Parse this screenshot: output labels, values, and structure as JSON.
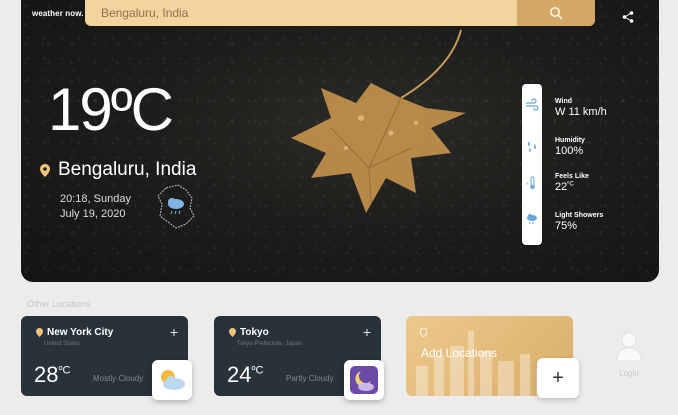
{
  "app": {
    "brand": "weather now."
  },
  "search": {
    "placeholder": "Bengaluru, India",
    "value": ""
  },
  "current": {
    "temperature": "19",
    "unit": "ºC",
    "city": "Bengaluru, India",
    "time_day": "20:18, Sunday",
    "date": "July 19, 2020"
  },
  "stats": [
    {
      "label": "Wind",
      "value": "W 11 km/h",
      "icon": "wind-icon"
    },
    {
      "label": "Humidity",
      "value": "100%",
      "icon": "droplets-icon"
    },
    {
      "label": "Feels Like",
      "value": "22",
      "unit": "ºC",
      "icon": "thermometer-icon"
    },
    {
      "label": "Light Showers",
      "value": "75%",
      "icon": "rain-cloud-icon"
    }
  ],
  "other": {
    "title": "Other Locations",
    "locations": [
      {
        "name": "New York City",
        "region": "United States",
        "temp": "28",
        "unit": "ºC",
        "condition": "Mostly Cloudy",
        "icon": "sun-cloud-icon"
      },
      {
        "name": "Tokyo",
        "region": "Tokyo Prefecture, Japan",
        "temp": "24",
        "unit": "ºC",
        "condition": "Partly Cloudy",
        "icon": "moon-cloud-icon"
      }
    ],
    "add_label": "Add Locations"
  },
  "user": {
    "login_label": "Login"
  },
  "colors": {
    "accent": "#f4d39c",
    "accent_dark": "#d6a866",
    "card": "#27323a",
    "hero": "#1d1d1b"
  }
}
